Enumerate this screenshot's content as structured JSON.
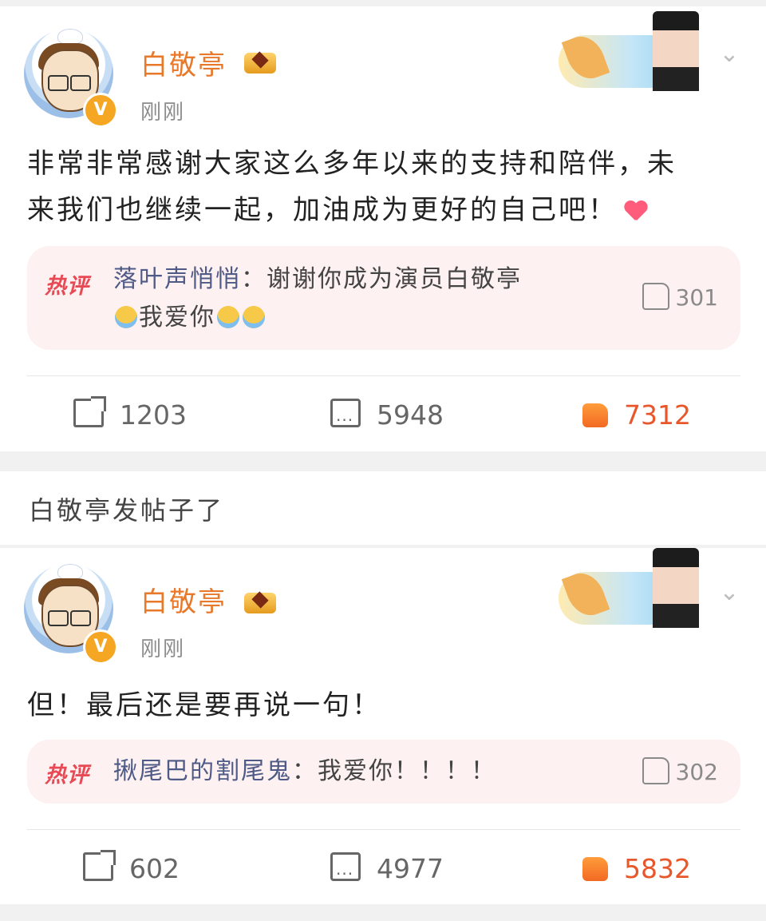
{
  "posts": [
    {
      "username": "白敬亭",
      "time": "刚刚",
      "verified_badge": "V",
      "text_line1": "非常非常感谢大家这么多年以来的支持和陪伴，未",
      "text_line2": "来我们也继续一起，加油成为更好的自己吧！",
      "hot_comment": {
        "tag": "热评",
        "user": "落叶声悄悄",
        "separator": "：",
        "text_line1": "谢谢你成为演员白敬亭",
        "text_line2": "我爱你",
        "likes": "301"
      },
      "actions": {
        "share": "1203",
        "comments": "5948",
        "likes": "7312"
      }
    },
    {
      "username": "白敬亭",
      "time": "刚刚",
      "verified_badge": "V",
      "text_line1": "但！最后还是要再说一句！",
      "hot_comment": {
        "tag": "热评",
        "user": "揪尾巴的割尾鬼",
        "separator": "：",
        "text_line1": "我爱你！！！！",
        "likes": "302"
      },
      "actions": {
        "share": "602",
        "comments": "4977",
        "likes": "5832"
      }
    }
  ],
  "notice": {
    "text": "白敬亭发帖子了"
  },
  "colors": {
    "username": "#e8792b",
    "like_active": "#e8572b",
    "hot_tag": "#e84a55",
    "hot_user": "#4f5a86",
    "hot_bg": "#fdf1f1"
  },
  "icons": [
    "avatar",
    "verified-badge",
    "crown-badge",
    "header-decoration",
    "chevron-down-icon",
    "thumb-up-icon",
    "share-icon",
    "comment-icon",
    "like-icon",
    "heart-emoji",
    "crying-emoji"
  ]
}
